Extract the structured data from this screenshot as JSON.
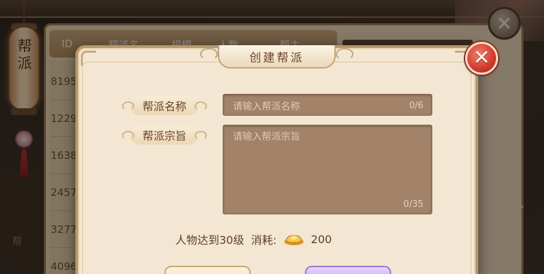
{
  "lantern": {
    "label": "帮派"
  },
  "guild_list": {
    "headers": [
      "ID",
      "帮派名",
      "规模",
      "人数",
      "帮主"
    ],
    "ids": [
      "8195",
      "1229",
      "1638",
      "2457",
      "3277",
      "4096"
    ],
    "side_text": "帮"
  },
  "dialog": {
    "title": "创建帮派",
    "name_label": "帮派名称",
    "name_placeholder": "请输入帮派名称",
    "name_counter": "0/6",
    "motto_label": "帮派宗旨",
    "motto_placeholder": "请输入帮派宗旨",
    "motto_counter": "0/35",
    "requirement": "人物达到30级",
    "cost_label": "消耗:",
    "cost_icon": "gold-ingot-icon",
    "cost_value": "200"
  },
  "colors": {
    "dialog_bg": "#f3e7d3",
    "field_bg": "#a2836a",
    "close_red": "#d13b2c",
    "title_brown": "#6b4428"
  }
}
